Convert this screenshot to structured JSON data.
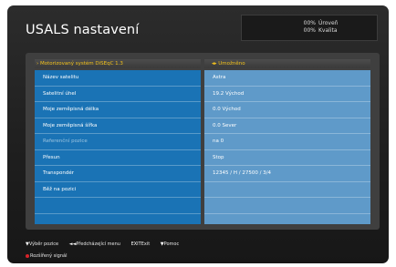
{
  "title": "USALS nastavení",
  "signal": {
    "level_pct": "00%",
    "level_label": "Úroveň",
    "quality_pct": "00%",
    "quality_label": "Kvalita"
  },
  "headers": {
    "left": "Motorizovaný systém DiSEqC 1.3",
    "right": "Umožněno"
  },
  "rows": [
    {
      "label": "Název satelitu",
      "value": "Astra"
    },
    {
      "label": "Satelitní úhel",
      "value": "19.2 Východ"
    },
    {
      "label": "Moje zeměpisná délka",
      "value": "0.0 Východ"
    },
    {
      "label": "Moje zeměpisná šířka",
      "value": "0.0 Sever"
    },
    {
      "label": "Referenční pozice",
      "value": "na 0"
    },
    {
      "label": "Přesun",
      "value": "Stop"
    },
    {
      "label": "Transpondér",
      "value": "12345 / H / 27500 / 3/4"
    },
    {
      "label": "Běž na pozici",
      "value": ""
    },
    {
      "label": "",
      "value": ""
    }
  ],
  "footer": {
    "keys": [
      {
        "key": "▼",
        "label": "Výběr pozice"
      },
      {
        "key": "◄◄",
        "label": "Předcházející menu"
      },
      {
        "key": "EXIT",
        "label": "Exit"
      },
      {
        "key": "▼",
        "label": "Pomoc"
      }
    ],
    "extended_signal": "Rozšířený signál"
  },
  "colors": {
    "header_text": "#f3c21d",
    "left_column": "#1a73b5",
    "right_column": "#5f9ac9",
    "background": "#222222"
  }
}
